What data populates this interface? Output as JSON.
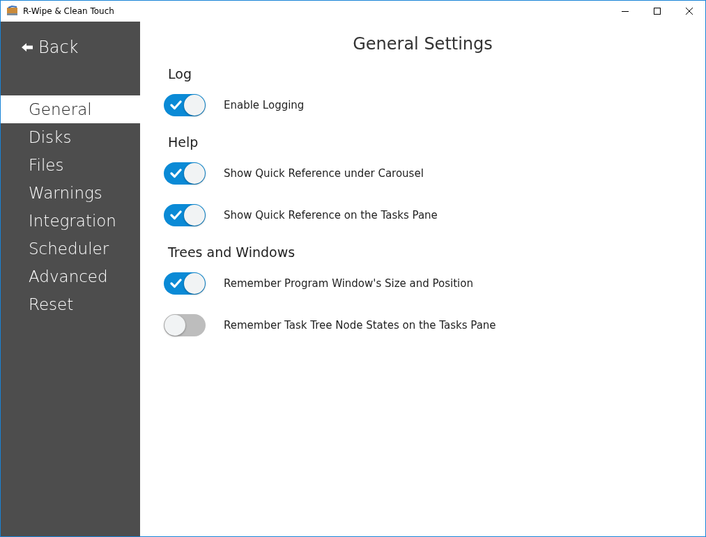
{
  "window": {
    "title": "R-Wipe & Clean Touch"
  },
  "back": {
    "label": "Back"
  },
  "sidebar": {
    "items": [
      {
        "label": "General",
        "selected": true
      },
      {
        "label": "Disks",
        "selected": false
      },
      {
        "label": "Files",
        "selected": false
      },
      {
        "label": "Warnings",
        "selected": false
      },
      {
        "label": "Integration",
        "selected": false
      },
      {
        "label": "Scheduler",
        "selected": false
      },
      {
        "label": "Advanced",
        "selected": false
      },
      {
        "label": "Reset",
        "selected": false
      }
    ]
  },
  "page_title": "General Settings",
  "sections": [
    {
      "heading": "Log",
      "items": [
        {
          "label": "Enable Logging",
          "on": true
        }
      ]
    },
    {
      "heading": "Help",
      "items": [
        {
          "label": "Show Quick Reference under Carousel",
          "on": true
        },
        {
          "label": "Show Quick Reference on the Tasks Pane",
          "on": true
        }
      ]
    },
    {
      "heading": "Trees and Windows",
      "items": [
        {
          "label": "Remember Program Window's Size and Position",
          "on": true
        },
        {
          "label": "Remember Task Tree Node States on the Tasks Pane",
          "on": false
        }
      ]
    }
  ]
}
